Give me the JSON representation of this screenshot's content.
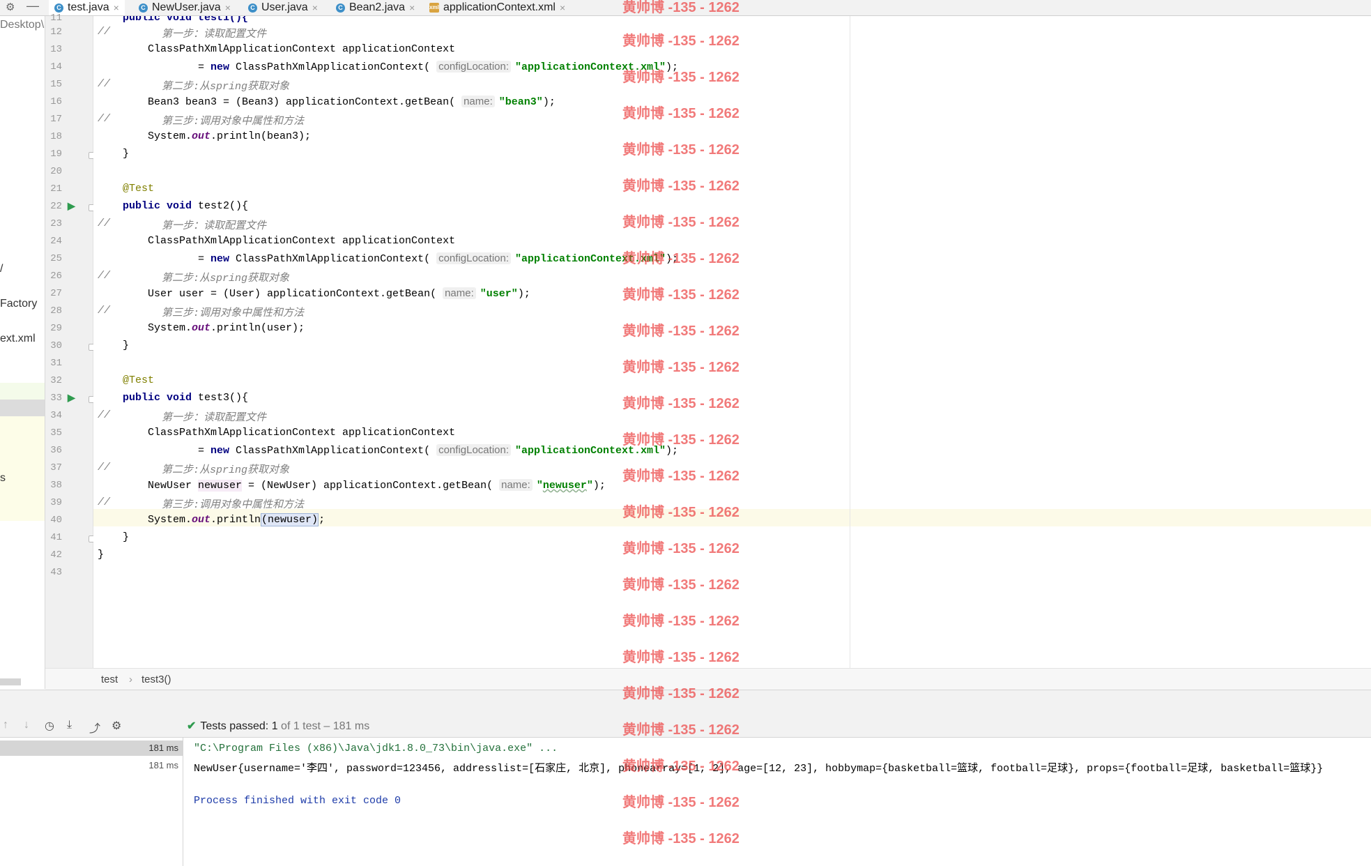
{
  "tabs": [
    {
      "label": "test.java",
      "active": true
    },
    {
      "label": "NewUser.java",
      "active": false
    },
    {
      "label": "User.java",
      "active": false
    },
    {
      "label": "Bean2.java",
      "active": false
    },
    {
      "label": "applicationContext.xml",
      "active": false
    }
  ],
  "project_panel": {
    "items": [
      "Desktop\\",
      "/",
      "Factory",
      "ext.xml",
      "s"
    ]
  },
  "gutter": {
    "lines": [
      "11",
      "12",
      "13",
      "14",
      "15",
      "16",
      "17",
      "18",
      "19",
      "20",
      "21",
      "22",
      "23",
      "24",
      "25",
      "26",
      "27",
      "28",
      "29",
      "30",
      "31",
      "32",
      "33",
      "34",
      "35",
      "36",
      "37",
      "38",
      "39",
      "40",
      "41",
      "42",
      "43"
    ]
  },
  "code": {
    "l11": "public void test1(){",
    "c_slash": "//",
    "c_step1": "第一步：读取配置文件",
    "c_step2": "第二步:从spring获取对象",
    "c_step3": "第三步:调用对象中属性和方法",
    "cpx_decl": "ClassPathXmlApplicationContext applicationContext",
    "eq": "= ",
    "kw_new": "new",
    "cpx_ctor": " ClassPathXmlApplicationContext(",
    "hint_config": "configLocation:",
    "str_xml": "\"applicationContext.xml\"",
    "close_paren_semi": ");",
    "bean3_get": "Bean3 bean3 = (Bean3) applicationContext.getBean(",
    "hint_name": "name:",
    "str_bean3": "\"bean3\"",
    "println_pre": "System.",
    "out": "out",
    "println_bean3": ".println(bean3);",
    "brace_close": "}",
    "ann_test": "@Test",
    "kw_public": "public",
    "kw_void": "void",
    "test2_sig": " test2(){",
    "test3_sig": " test3(){",
    "user_get": "User user = (User) applicationContext.getBean(",
    "str_user": "\"user\"",
    "println_user": ".println(user);",
    "newuser_type": "NewUser ",
    "newuser_var": "newuser",
    "newuser_cast": " = (NewUser) applicationContext.getBean(",
    "str_newuser_q": "\"",
    "str_newuser_v": "newuser",
    "println_open": ".println",
    "println_arg": "(newuser)",
    "semi": ";"
  },
  "breadcrumb": {
    "items": [
      "test",
      "test3()"
    ],
    "separator": "›"
  },
  "run": {
    "status_main": "Tests passed:",
    "status_count": "1",
    "status_rest": "of 1 test – 181 ms",
    "tree_times": [
      "181 ms",
      "181 ms"
    ],
    "console": [
      "\"C:\\Program Files (x86)\\Java\\jdk1.8.0_73\\bin\\java.exe\" ...",
      "NewUser{username='李四', password=123456, addresslist=[石家庄, 北京], phonearray=[1, 2], age=[12, 23], hobbymap={basketball=篮球, football=足球}, props={football=足球, basketball=篮球}}",
      "",
      "Process finished with exit code 0"
    ]
  },
  "watermark": {
    "text": "黄帅博 -135 - 1262"
  },
  "colors": {
    "keyword": "#000080",
    "string": "#008000",
    "comment": "#808080",
    "annotation": "#808000",
    "watermark": "#eb4646"
  }
}
